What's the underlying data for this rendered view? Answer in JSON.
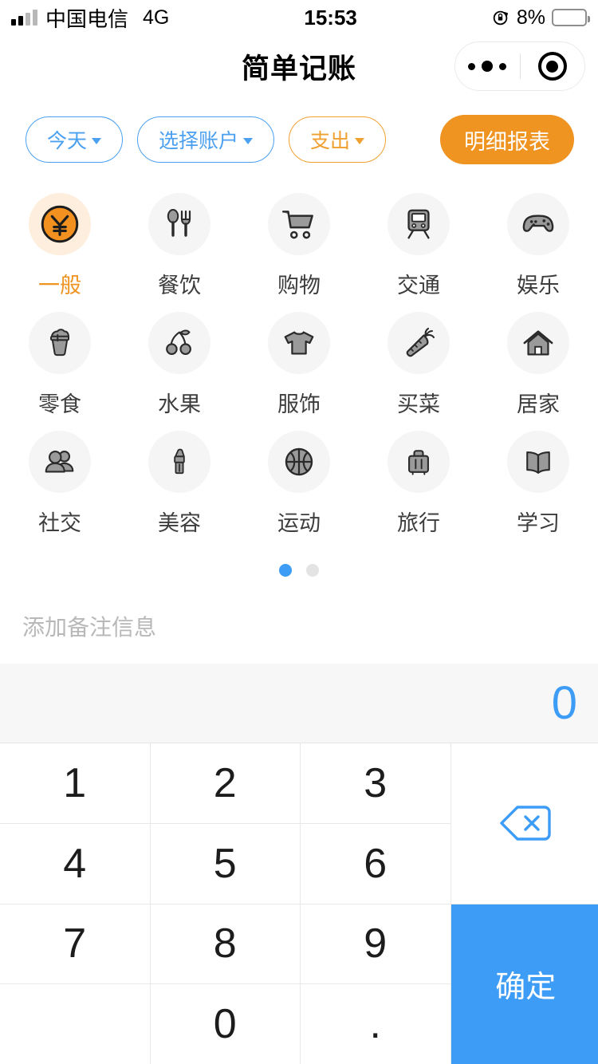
{
  "status_bar": {
    "carrier": "中国电信",
    "network": "4G",
    "time": "15:53",
    "battery_percent": "8%",
    "battery_level": 8,
    "rotation_lock_icon": "rotation-lock-icon",
    "signal_icon": "signal-bars-icon"
  },
  "nav": {
    "title": "简单记账",
    "menu_icon": "more-dots-icon",
    "target_icon": "circle-target-icon"
  },
  "filters": {
    "date": {
      "label": "今天",
      "color": "#4ba0f0"
    },
    "account": {
      "label": "选择账户",
      "color": "#4ba0f0"
    },
    "type": {
      "label": "支出",
      "color": "#f0a030"
    },
    "report_button": {
      "label": "明细报表",
      "color": "#ef9321"
    }
  },
  "categories": {
    "selected": "一般",
    "accent": "#ef9321",
    "rows": [
      [
        {
          "label": "一般",
          "icon": "yen-coin-icon",
          "active": true
        },
        {
          "label": "餐饮",
          "icon": "spoon-fork-icon",
          "active": false
        },
        {
          "label": "购物",
          "icon": "shopping-cart-icon",
          "active": false
        },
        {
          "label": "交通",
          "icon": "train-icon",
          "active": false
        },
        {
          "label": "娱乐",
          "icon": "gamepad-icon",
          "active": false
        }
      ],
      [
        {
          "label": "零食",
          "icon": "ice-cream-cup-icon",
          "active": false
        },
        {
          "label": "水果",
          "icon": "cherries-icon",
          "active": false
        },
        {
          "label": "服饰",
          "icon": "tshirt-icon",
          "active": false
        },
        {
          "label": "买菜",
          "icon": "carrot-icon",
          "active": false
        },
        {
          "label": "居家",
          "icon": "house-icon",
          "active": false
        }
      ],
      [
        {
          "label": "社交",
          "icon": "people-icon",
          "active": false
        },
        {
          "label": "美容",
          "icon": "lipstick-icon",
          "active": false
        },
        {
          "label": "运动",
          "icon": "basketball-icon",
          "active": false
        },
        {
          "label": "旅行",
          "icon": "suitcase-icon",
          "active": false
        },
        {
          "label": "学习",
          "icon": "open-book-icon",
          "active": false
        }
      ]
    ]
  },
  "pager": {
    "total": 2,
    "active_index": 0,
    "active_color": "#3d9cf5",
    "inactive_color": "#e3e3e3"
  },
  "note": {
    "value": "",
    "placeholder": "添加备注信息"
  },
  "amount": {
    "value": "0",
    "color": "#3d9cf5"
  },
  "keypad": {
    "keys": [
      "1",
      "2",
      "3",
      "4",
      "5",
      "6",
      "7",
      "8",
      "9",
      "",
      "0",
      "."
    ],
    "delete_icon": "backspace-icon",
    "confirm_label": "确定",
    "confirm_color": "#3d9cf5"
  }
}
